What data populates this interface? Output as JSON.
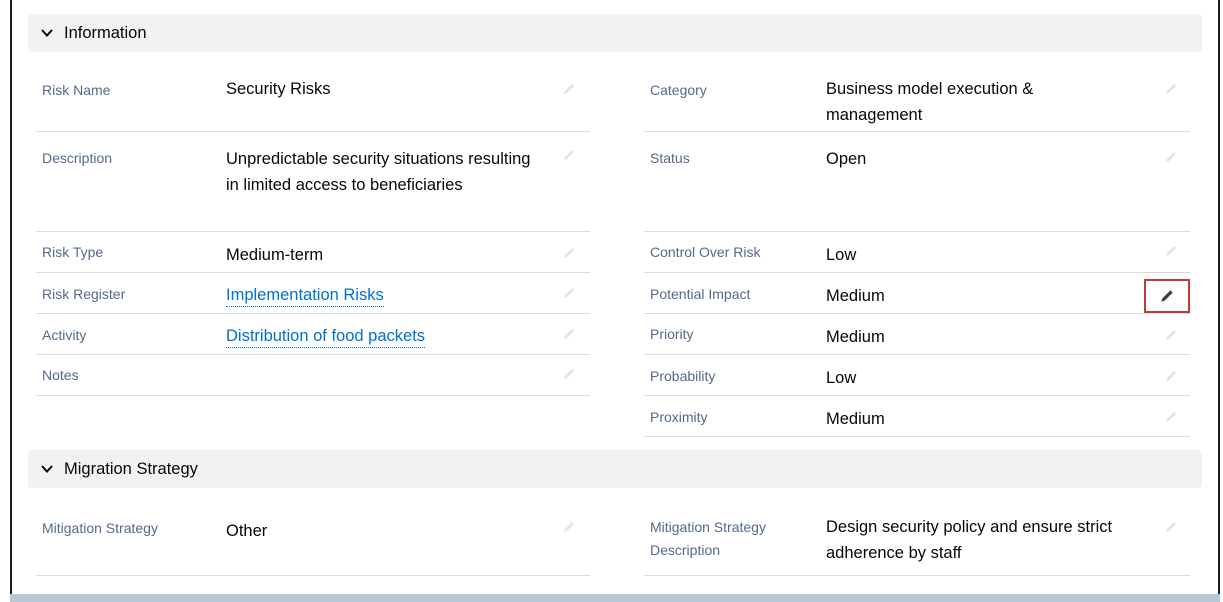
{
  "sections": {
    "information": {
      "title": "Information"
    },
    "migration": {
      "title": "Migration Strategy"
    }
  },
  "fields": {
    "risk_name": {
      "label": "Risk Name",
      "value": "Security Risks"
    },
    "description": {
      "label": "Description",
      "value": "Unpredictable security situations resulting in limited access to beneficiaries"
    },
    "risk_type": {
      "label": "Risk Type",
      "value": "Medium-term"
    },
    "risk_register": {
      "label": "Risk Register",
      "value": "Implementation Risks"
    },
    "activity": {
      "label": "Activity",
      "value": "Distribution of food packets"
    },
    "notes": {
      "label": "Notes",
      "value": ""
    },
    "category": {
      "label": "Category",
      "value": "Business model execution & management"
    },
    "status": {
      "label": "Status",
      "value": "Open"
    },
    "control_over_risk": {
      "label": "Control Over Risk",
      "value": "Low"
    },
    "potential_impact": {
      "label": "Potential Impact",
      "value": "Medium"
    },
    "priority": {
      "label": "Priority",
      "value": "Medium"
    },
    "probability": {
      "label": "Probability",
      "value": "Low"
    },
    "proximity": {
      "label": "Proximity",
      "value": "Medium"
    },
    "mitigation_strategy": {
      "label": "Mitigation Strategy",
      "value": "Other"
    },
    "mitigation_strategy_description": {
      "label": "Mitigation Strategy Description",
      "value": "Design security policy and ensure strict adherence by staff"
    }
  },
  "icons": {
    "section_toggle": "chevron-down-icon",
    "edit": "pencil-icon"
  },
  "colors": {
    "link": "#0070d2",
    "label": "#54698d",
    "highlight_border": "#c23934",
    "section_bg": "#f3f2f2"
  }
}
